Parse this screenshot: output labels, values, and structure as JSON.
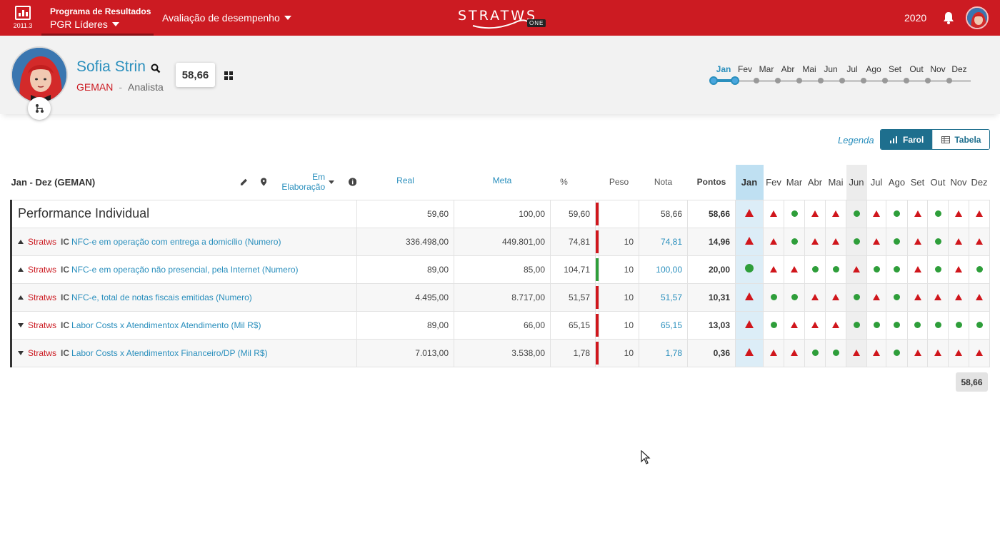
{
  "topbar": {
    "version": "2011.3",
    "program_title": "Programa de Resultados",
    "program_name": "PGR Líderes",
    "eval_menu": "Avaliação de desempenho",
    "logo_text": "STRATWS",
    "logo_badge": "ONE",
    "year": "2020",
    "brand_color": "#cc1b22"
  },
  "profile": {
    "name": "Sofia Strin",
    "org": "GEMAN",
    "separator": "-",
    "role": "Analista",
    "score": "58,66",
    "timeline_months": [
      "Jan",
      "Fev",
      "Mar",
      "Abr",
      "Mai",
      "Jun",
      "Jul",
      "Ago",
      "Set",
      "Out",
      "Nov",
      "Dez"
    ],
    "timeline_selected": "Jan"
  },
  "view": {
    "legend_label": "Legenda",
    "farol_label": "Farol",
    "tabela_label": "Tabela"
  },
  "table": {
    "period_title": "Jan - Dez (GEMAN)",
    "status": "Em Elaboração",
    "headers": {
      "real": "Real",
      "meta": "Meta",
      "pct": "%",
      "peso": "Peso",
      "nota": "Nota",
      "pontos": "Pontos"
    },
    "months": [
      "Jan",
      "Fev",
      "Mar",
      "Abr",
      "Mai",
      "Jun",
      "Jul",
      "Ago",
      "Set",
      "Out",
      "Nov",
      "Dez"
    ],
    "summary": {
      "name": "Performance Individual",
      "real": "59,60",
      "meta": "100,00",
      "pct": "59,60",
      "bar": "red",
      "peso": "",
      "nota": "58,66",
      "pontos": "58,66",
      "lights": [
        "tri",
        "tri",
        "dot",
        "tri",
        "tri",
        "dot",
        "tri",
        "dot",
        "tri",
        "dot",
        "tri",
        "tri"
      ]
    },
    "rows": [
      {
        "dir": "up",
        "org": "Stratws",
        "type": "IC",
        "name": "NFC-e em operação com entrega a domicílio (Numero)",
        "real": "336.498,00",
        "meta": "449.801,00",
        "pct": "74,81",
        "bar": "red",
        "peso": "10",
        "nota": "74,81",
        "pontos": "14,96",
        "lights": [
          "tri",
          "tri",
          "dot",
          "tri",
          "tri",
          "dot",
          "tri",
          "dot",
          "tri",
          "dot",
          "tri",
          "tri"
        ]
      },
      {
        "dir": "up",
        "org": "Stratws",
        "type": "IC",
        "name": "NFC-e em operação não presencial, pela Internet (Numero)",
        "real": "89,00",
        "meta": "85,00",
        "pct": "104,71",
        "bar": "green",
        "peso": "10",
        "nota": "100,00",
        "pontos": "20,00",
        "lights": [
          "dot",
          "tri",
          "tri",
          "dot",
          "dot",
          "tri",
          "dot",
          "dot",
          "tri",
          "dot",
          "tri",
          "dot"
        ]
      },
      {
        "dir": "up",
        "org": "Stratws",
        "type": "IC",
        "name": "NFC-e, total de notas fiscais emitidas (Numero)",
        "real": "4.495,00",
        "meta": "8.717,00",
        "pct": "51,57",
        "bar": "red",
        "peso": "10",
        "nota": "51,57",
        "pontos": "10,31",
        "lights": [
          "tri",
          "dot",
          "dot",
          "tri",
          "tri",
          "dot",
          "tri",
          "dot",
          "tri",
          "tri",
          "tri",
          "tri"
        ]
      },
      {
        "dir": "down",
        "org": "Stratws",
        "type": "IC",
        "name": "Labor Costs x Atendimentox Atendimento (Mil R$)",
        "real": "89,00",
        "meta": "66,00",
        "pct": "65,15",
        "bar": "red",
        "peso": "10",
        "nota": "65,15",
        "pontos": "13,03",
        "lights": [
          "tri",
          "dot",
          "tri",
          "tri",
          "tri",
          "dot",
          "dot",
          "dot",
          "dot",
          "dot",
          "dot",
          "dot"
        ]
      },
      {
        "dir": "down",
        "org": "Stratws",
        "type": "IC",
        "name": "Labor Costs x Atendimentox Financeiro/DP (Mil R$)",
        "real": "7.013,00",
        "meta": "3.538,00",
        "pct": "1,78",
        "bar": "red",
        "peso": "10",
        "nota": "1,78",
        "pontos": "0,36",
        "lights": [
          "tri",
          "tri",
          "tri",
          "dot",
          "dot",
          "tri",
          "tri",
          "dot",
          "tri",
          "tri",
          "tri",
          "tri"
        ]
      }
    ],
    "total": "58,66"
  },
  "colors": {
    "red": "#d0161c",
    "green": "#2e9e3a",
    "accent": "#2a8fbd"
  }
}
